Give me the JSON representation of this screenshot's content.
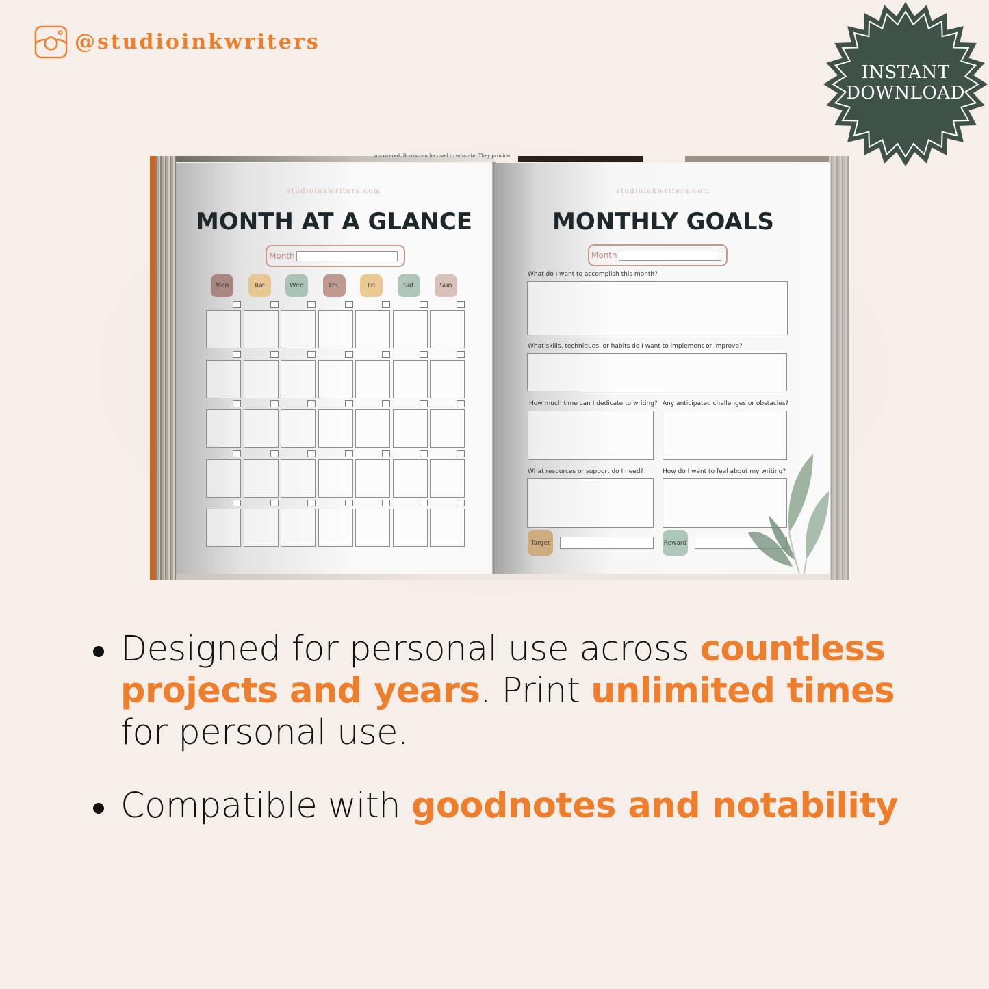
{
  "header": {
    "handle": "@studioinkwriters",
    "icon": "instagram-icon",
    "accent_color": "#ee7d2c"
  },
  "badge": {
    "line1": "INSTANT",
    "line2": "DOWNLOAD",
    "color": "#3f5248"
  },
  "book": {
    "top_strip_text": "uncovered. Books can be used to educate. They provide",
    "left_page": {
      "site": "studioinkwriters.com",
      "title": "MONTH AT A GLANCE",
      "month_label": "Month",
      "month_value": "",
      "days": [
        {
          "label": "Mon",
          "color": "#a98680"
        },
        {
          "label": "Tue",
          "color": "#e8c790"
        },
        {
          "label": "Wed",
          "color": "#a9c3b4"
        },
        {
          "label": "Thu",
          "color": "#c0998f"
        },
        {
          "label": "Fri",
          "color": "#ecc991"
        },
        {
          "label": "Sat",
          "color": "#aec6b8"
        },
        {
          "label": "Sun",
          "color": "#d9c0b8"
        }
      ],
      "weeks": 5
    },
    "right_page": {
      "site": "studioinkwriters.com",
      "title": "MONTHLY GOALS",
      "month_label": "Month",
      "month_value": "",
      "questions": [
        "What do I want to accomplish this month?",
        "What skills, techniques, or habits do I want to implement or improve?",
        "How much time can I dedicate to writing?",
        "Any anticipated challenges or obstacles?",
        "What resources or support do I need?",
        "How do I want to feel about my writing?"
      ],
      "target_label": "Target",
      "target_color": "#cfad7e",
      "target_value": "",
      "reward_label": "Reward",
      "reward_color": "#afc7b9",
      "reward_value": ""
    }
  },
  "bullets": [
    {
      "parts": [
        {
          "text": "Designed for personal use across ",
          "highlight": false
        },
        {
          "text": "countless projects and years",
          "highlight": true
        },
        {
          "text": ". Print ",
          "highlight": false
        },
        {
          "text": "unlimited times",
          "highlight": true
        },
        {
          "text": " for personal use.",
          "highlight": false
        }
      ]
    },
    {
      "parts": [
        {
          "text": "Compatible with ",
          "highlight": false
        },
        {
          "text": "goodnotes and notability",
          "highlight": true
        }
      ]
    }
  ]
}
